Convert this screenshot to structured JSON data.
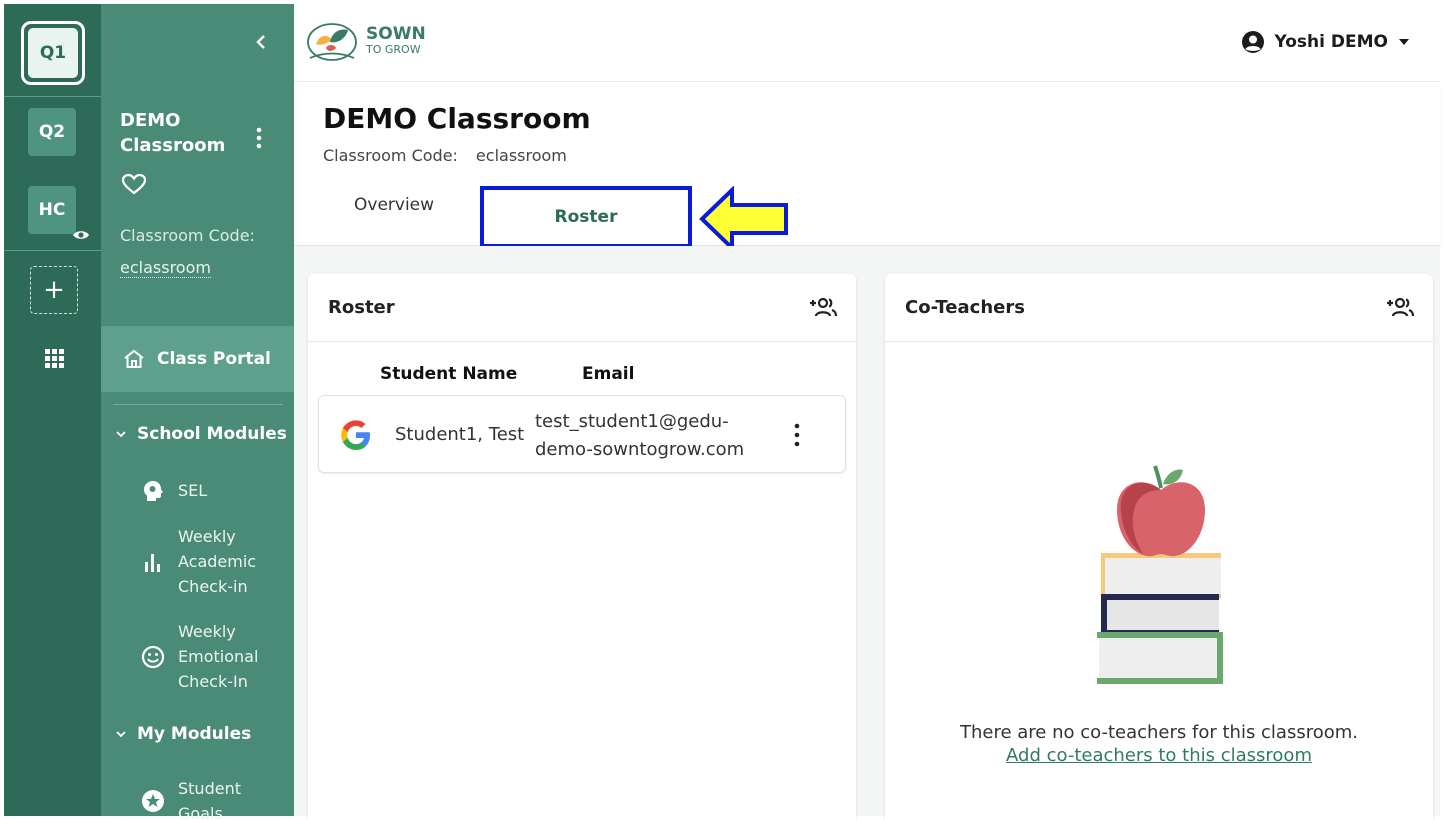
{
  "rail": {
    "items": [
      {
        "label": "Q1"
      },
      {
        "label": "Q2"
      },
      {
        "label": "HC"
      }
    ]
  },
  "sidebar": {
    "class_name_line1": "DEMO",
    "class_name_line2": "Classroom",
    "code_label": "Classroom Code:",
    "code_value": "eclassroom",
    "portal_label": "Class Portal",
    "school_modules_label": "School Modules",
    "school_modules": [
      {
        "line1": "SEL",
        "icon": "brain-head-icon"
      },
      {
        "line1": "Weekly",
        "line2": "Academic",
        "line3": "Check-in",
        "icon": "bar-chart-icon"
      },
      {
        "line1": "Weekly",
        "line2": "Emotional",
        "line3": "Check-In",
        "icon": "smiley-icon"
      }
    ],
    "my_modules_label": "My Modules",
    "my_modules": [
      {
        "line1": "Student",
        "line2": "Goals",
        "icon": "star-badge-icon"
      }
    ]
  },
  "header": {
    "brand_top": "SOWN",
    "brand_bottom": "TO GROW",
    "user_name": "Yoshi DEMO"
  },
  "page": {
    "title": "DEMO Classroom",
    "code_label": "Classroom Code:",
    "code_value": "eclassroom",
    "tabs": [
      {
        "label": "Overview"
      },
      {
        "label": "Roster"
      }
    ]
  },
  "roster": {
    "title": "Roster",
    "col_name": "Student Name",
    "col_email": "Email",
    "students": [
      {
        "name": "Student1, Test",
        "email_line1": "test_student1@gedu-",
        "email_line2": "demo-sowntogrow.com"
      }
    ]
  },
  "coteachers": {
    "title": "Co-Teachers",
    "empty_text": "There are no co-teachers for this classroom.",
    "empty_link": "Add co-teachers to this classroom"
  },
  "colors": {
    "rail": "#2d6a57",
    "sidebar": "#4a8b78",
    "highlight_box": "#0a1be0",
    "arrow_fill": "#ffff33"
  }
}
